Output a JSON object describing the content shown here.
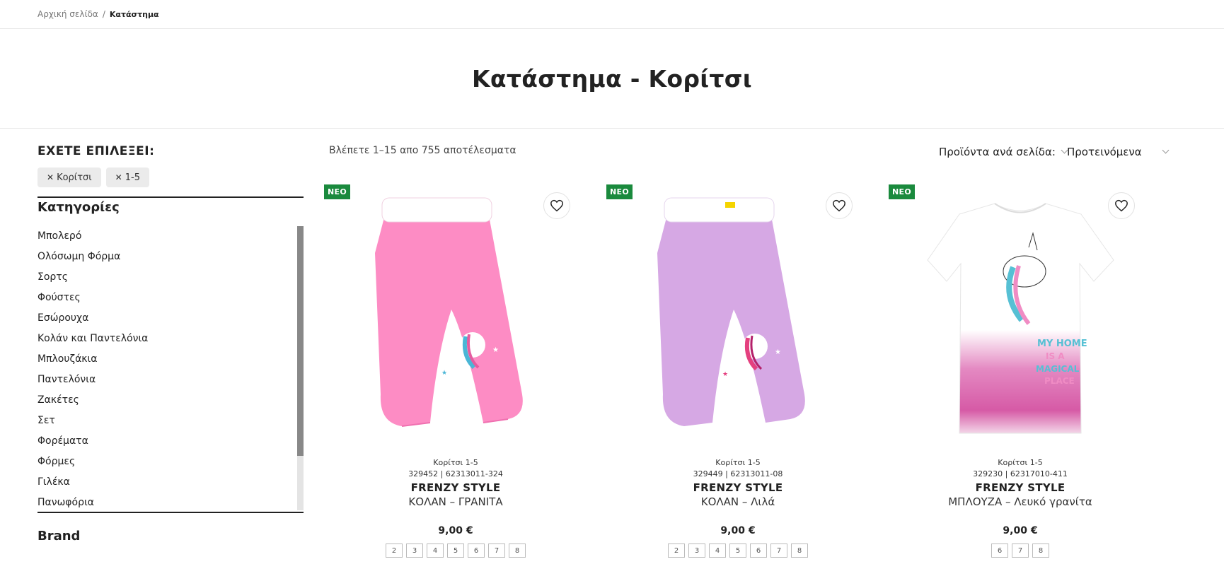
{
  "breadcrumb": {
    "home": "Αρχική σελίδα",
    "separator": "/",
    "current": "Κατάστημα"
  },
  "page_title": "Κατάστημα - Κορίτσι",
  "filters": {
    "title": "ΕΧΕΤΕ ΕΠΙΛΕΞΕΙ:",
    "chips": [
      {
        "label": "Κορίτσι"
      },
      {
        "label": "1-5"
      }
    ]
  },
  "categories": {
    "title": "Κατηγορίες",
    "items": [
      "Μπολερό",
      "Ολόσωμη Φόρμα",
      "Σορτς",
      "Φούστες",
      "Εσώρουχα",
      "Κολάν και Παντελόνια",
      "Μπλουζάκια",
      "Παντελόνια",
      "Ζακέτες",
      "Σετ",
      "Φορέματα",
      "Φόρμες",
      "Γιλέκα",
      "Πανωφόρια"
    ],
    "scroll_position": 0.0
  },
  "brand_title": "Brand",
  "results_text": "Βλέπετε 1–15 απο 755 αποτέλεσματα",
  "per_page_label": "Προϊόντα ανά σελίδα:",
  "sort_label": "Προτεινόμενα",
  "colors": {
    "badge": "#1a8a3d",
    "pink_leggings": "#fd8cc4",
    "lilac_leggings": "#d6a8e4"
  },
  "products": [
    {
      "badge": "ΝΕΟ",
      "category": "Κορίτσι 1-5",
      "sku": "329452 | 62313011-324",
      "brand": "FRENZY STYLE",
      "name": "ΚΟΛΑΝ – ΓΡΑΝΙΤΑ",
      "price": "9,00 €",
      "sizes": [
        "2",
        "3",
        "4",
        "5",
        "6",
        "7",
        "8"
      ],
      "image": "pink-leggings-unicorn"
    },
    {
      "badge": "ΝΕΟ",
      "category": "Κορίτσι 1-5",
      "sku": "329449 | 62313011-08",
      "brand": "FRENZY STYLE",
      "name": "ΚΟΛΑΝ – Λιλά",
      "price": "9,00 €",
      "sizes": [
        "2",
        "3",
        "4",
        "5",
        "6",
        "7",
        "8"
      ],
      "image": "lilac-leggings-unicorn"
    },
    {
      "badge": "ΝΕΟ",
      "category": "Κορίτσι 1-5",
      "sku": "329230 | 62317010-411",
      "brand": "FRENZY STYLE",
      "name": "ΜΠΛΟΥΖΑ – Λευκό γρανίτα",
      "price": "9,00 €",
      "sizes": [
        "6",
        "7",
        "8"
      ],
      "image": "white-tshirt-unicorn"
    }
  ]
}
